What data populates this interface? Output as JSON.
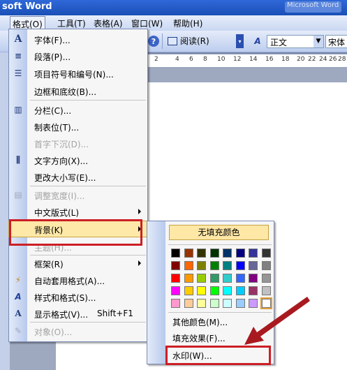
{
  "window": {
    "title": "soft Word",
    "title_right_ghost": "Microsoft Word"
  },
  "menubar": [
    {
      "id": "format",
      "label": "格式(O)",
      "active": true
    },
    {
      "id": "tools",
      "label": "工具(T)"
    },
    {
      "id": "table",
      "label": "表格(A)"
    },
    {
      "id": "window",
      "label": "窗口(W)"
    },
    {
      "id": "help",
      "label": "帮助(H)"
    }
  ],
  "toolbar": {
    "read_label": "阅读(R)",
    "style_value": "正文",
    "font_value": "宋体"
  },
  "ruler": {
    "ticks": [
      "2",
      "4",
      "6",
      "8",
      "10",
      "12",
      "14",
      "16",
      "18",
      "20",
      "22",
      "24",
      "26",
      "28"
    ]
  },
  "format_menu": {
    "items": [
      {
        "id": "font",
        "label": "字体(F)...",
        "icon": "A"
      },
      {
        "id": "paragraph",
        "label": "段落(P)...",
        "icon": "≡"
      },
      {
        "id": "bullets",
        "label": "项目符号和编号(N)...",
        "icon": "☰"
      },
      {
        "id": "borders",
        "label": "边框和底纹(B)..."
      },
      {
        "sep": true
      },
      {
        "id": "columns",
        "label": "分栏(C)...",
        "icon": "▥"
      },
      {
        "id": "tabs",
        "label": "制表位(T)..."
      },
      {
        "id": "dropcap",
        "label": "首字下沉(D)...",
        "disabled": true
      },
      {
        "id": "textdir",
        "label": "文字方向(X)...",
        "icon": "⫼"
      },
      {
        "id": "changecase",
        "label": "更改大小写(E)..."
      },
      {
        "sep": true
      },
      {
        "id": "fitwidth",
        "label": "调整宽度(I)...",
        "disabled": true,
        "icon": "▤"
      },
      {
        "id": "asian",
        "label": "中文版式(L)",
        "arrow": true
      },
      {
        "id": "background",
        "label": "背景(K)",
        "arrow": true,
        "highlight": true
      },
      {
        "id": "theme",
        "label": "主题(H)...",
        "disabled": true
      },
      {
        "id": "frames",
        "label": "框架(R)",
        "arrow": true
      },
      {
        "id": "autoformat",
        "label": "自动套用格式(A)...",
        "icon": "⚡"
      },
      {
        "id": "styles",
        "label": "样式和格式(S)...",
        "icon": "A"
      },
      {
        "id": "reveal",
        "label": "显示格式(V)...",
        "shortcut": "Shift+F1",
        "icon": "A"
      },
      {
        "id": "object",
        "label": "对象(O)...",
        "disabled": true
      }
    ]
  },
  "background_submenu": {
    "no_fill": "无填充颜色",
    "more_colors": "其他颜色(M)...",
    "fill_effects": "填充效果(F)...",
    "watermark": "水印(W)...",
    "colors": [
      [
        "#000000",
        "#993300",
        "#333300",
        "#003300",
        "#003366",
        "#000080",
        "#333399",
        "#333333"
      ],
      [
        "#800000",
        "#FF6600",
        "#808000",
        "#008000",
        "#008080",
        "#0000FF",
        "#666699",
        "#808080"
      ],
      [
        "#FF0000",
        "#FF9900",
        "#99CC00",
        "#339966",
        "#33CCCC",
        "#3366FF",
        "#800080",
        "#969696"
      ],
      [
        "#FF00FF",
        "#FFCC00",
        "#FFFF00",
        "#00FF00",
        "#00FFFF",
        "#00CCFF",
        "#993366",
        "#C0C0C0"
      ],
      [
        "#FF99CC",
        "#FFCC99",
        "#FFFF99",
        "#CCFFCC",
        "#CCFFFF",
        "#99CCFF",
        "#CC99FF",
        "#FFFFFF"
      ]
    ]
  }
}
